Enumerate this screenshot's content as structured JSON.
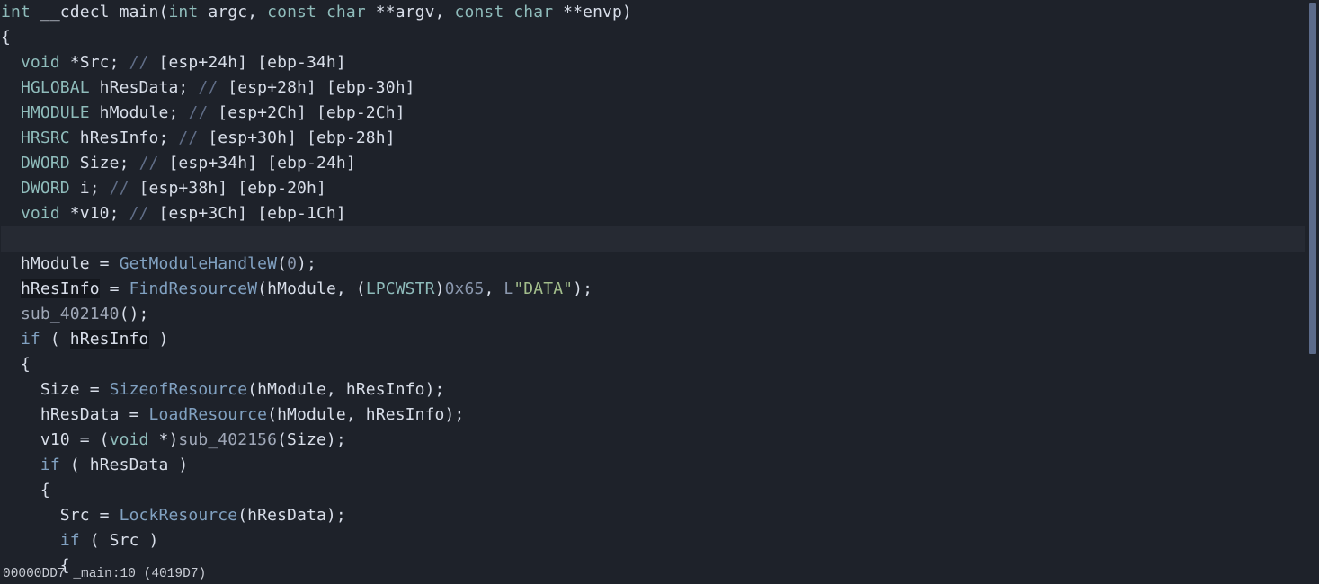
{
  "editor": {
    "current_line": 9,
    "lines": [
      [
        [
          "int",
          "type"
        ],
        [
          " __cdecl ",
          "text"
        ],
        [
          "main",
          "text"
        ],
        [
          "(",
          "text"
        ],
        [
          "int",
          "type"
        ],
        [
          " argc, ",
          "text"
        ],
        [
          "const",
          "type"
        ],
        [
          " ",
          "text"
        ],
        [
          "char",
          "type"
        ],
        [
          " **argv, ",
          "text"
        ],
        [
          "const",
          "type"
        ],
        [
          " ",
          "text"
        ],
        [
          "char",
          "type"
        ],
        [
          " **envp)",
          "text"
        ]
      ],
      [
        [
          "{",
          "text"
        ]
      ],
      [
        [
          "  ",
          "text"
        ],
        [
          "void",
          "type"
        ],
        [
          " *Src; ",
          "text"
        ],
        [
          "// ",
          "comment"
        ],
        [
          "[esp+24h] [ebp-34h]",
          "text"
        ]
      ],
      [
        [
          "  ",
          "text"
        ],
        [
          "HGLOBAL",
          "type"
        ],
        [
          " hResData; ",
          "text"
        ],
        [
          "// ",
          "comment"
        ],
        [
          "[esp+28h] [ebp-30h]",
          "text"
        ]
      ],
      [
        [
          "  ",
          "text"
        ],
        [
          "HMODULE",
          "type"
        ],
        [
          " hModule; ",
          "text"
        ],
        [
          "// ",
          "comment"
        ],
        [
          "[esp+2Ch] [ebp-2Ch]",
          "text"
        ]
      ],
      [
        [
          "  ",
          "text"
        ],
        [
          "HRSRC",
          "type"
        ],
        [
          " hResInfo; ",
          "text"
        ],
        [
          "// ",
          "comment"
        ],
        [
          "[esp+30h] [ebp-28h]",
          "text"
        ]
      ],
      [
        [
          "  ",
          "text"
        ],
        [
          "DWORD",
          "type"
        ],
        [
          " Size; ",
          "text"
        ],
        [
          "// ",
          "comment"
        ],
        [
          "[esp+34h] [ebp-24h]",
          "text"
        ]
      ],
      [
        [
          "  ",
          "text"
        ],
        [
          "DWORD",
          "type"
        ],
        [
          " i; ",
          "text"
        ],
        [
          "// ",
          "comment"
        ],
        [
          "[esp+38h] [ebp-20h]",
          "text"
        ]
      ],
      [
        [
          "  ",
          "text"
        ],
        [
          "void",
          "type"
        ],
        [
          " *v10; ",
          "text"
        ],
        [
          "// ",
          "comment"
        ],
        [
          "[esp+3Ch] [ebp-1Ch]",
          "text"
        ]
      ],
      [],
      [
        [
          "  hModule = ",
          "text"
        ],
        [
          "GetModuleHandleW",
          "func"
        ],
        [
          "(",
          "text"
        ],
        [
          "0",
          "num"
        ],
        [
          ");",
          "text"
        ]
      ],
      [
        [
          "  ",
          "text"
        ],
        [
          "hResInfo",
          "hl"
        ],
        [
          " = ",
          "text"
        ],
        [
          "FindResourceW",
          "func"
        ],
        [
          "(hModule, (",
          "text"
        ],
        [
          "LPCWSTR",
          "type"
        ],
        [
          ")",
          "text"
        ],
        [
          "0x65",
          "num"
        ],
        [
          ", ",
          "text"
        ],
        [
          "L",
          "num"
        ],
        [
          "\"DATA\"",
          "str"
        ],
        [
          ");",
          "text"
        ]
      ],
      [
        [
          "  ",
          "text"
        ],
        [
          "sub_402140",
          "sub"
        ],
        [
          "();",
          "text"
        ]
      ],
      [
        [
          "  ",
          "text"
        ],
        [
          "if",
          "kw"
        ],
        [
          " ( ",
          "text"
        ],
        [
          "hResInfo",
          "hl"
        ],
        [
          " )",
          "text"
        ]
      ],
      [
        [
          "  {",
          "text"
        ]
      ],
      [
        [
          "    Size = ",
          "text"
        ],
        [
          "SizeofResource",
          "func"
        ],
        [
          "(hModule, hResInfo);",
          "text"
        ]
      ],
      [
        [
          "    hResData = ",
          "text"
        ],
        [
          "LoadResource",
          "func"
        ],
        [
          "(hModule, hResInfo);",
          "text"
        ]
      ],
      [
        [
          "    v10 = (",
          "text"
        ],
        [
          "void",
          "type"
        ],
        [
          " *)",
          "text"
        ],
        [
          "sub_402156",
          "sub"
        ],
        [
          "(Size);",
          "text"
        ]
      ],
      [
        [
          "    ",
          "text"
        ],
        [
          "if",
          "kw"
        ],
        [
          " ( hResData )",
          "text"
        ]
      ],
      [
        [
          "    {",
          "text"
        ]
      ],
      [
        [
          "      Src = ",
          "text"
        ],
        [
          "LockResource",
          "func"
        ],
        [
          "(hResData);",
          "text"
        ]
      ],
      [
        [
          "      ",
          "text"
        ],
        [
          "if",
          "kw"
        ],
        [
          " ( Src )",
          "text"
        ]
      ],
      [
        [
          "      {",
          "text"
        ]
      ]
    ]
  },
  "status_bar": {
    "text": "00000DD7 _main:10 (4019D7)"
  },
  "colors": {
    "background": "#1e222a",
    "type": "#8fbcbb",
    "function": "#81a1c1",
    "comment": "#616e88",
    "string": "#a3be8c",
    "scroll_thumb": "#5c6b8a"
  }
}
